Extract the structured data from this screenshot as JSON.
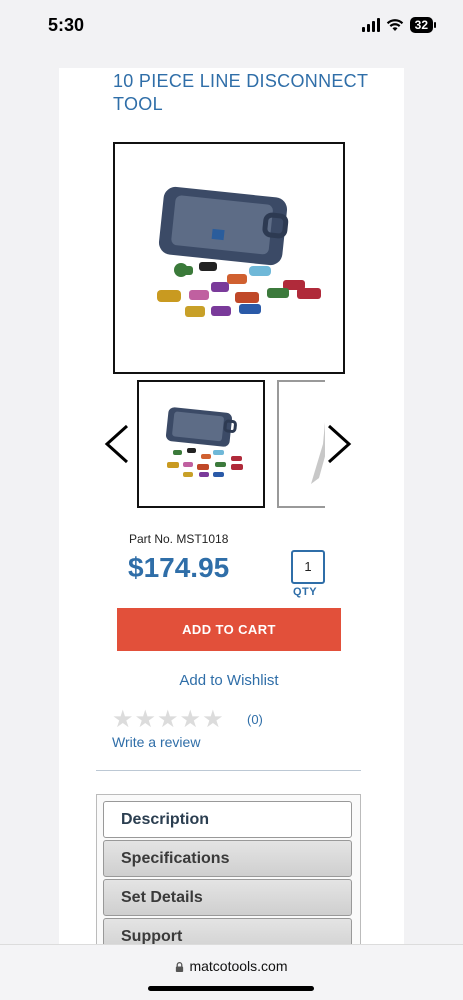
{
  "status_bar": {
    "time": "5:30",
    "battery": "32",
    "icons": [
      "signal-icon",
      "wifi-icon",
      "battery-icon"
    ]
  },
  "product": {
    "title": "10 PIECE LINE DISCONNECT TOOL",
    "part_no": "Part No. MST1018",
    "price": "$174.95",
    "qty_value": "1",
    "qty_label": "QTY",
    "add_to_cart": "ADD TO CART",
    "wishlist": "Add to Wishlist"
  },
  "reviews": {
    "rating": 0,
    "max": 5,
    "count": "(0)",
    "write": "Write a review"
  },
  "tabs": [
    {
      "label": "Description",
      "active": true
    },
    {
      "label": "Specifications",
      "active": false
    },
    {
      "label": "Set Details",
      "active": false
    },
    {
      "label": "Support",
      "active": false
    }
  ],
  "browser": {
    "url": "matcotools.com"
  },
  "colors": {
    "accent": "#2f6ea8",
    "cart_button": "#e2503a"
  }
}
